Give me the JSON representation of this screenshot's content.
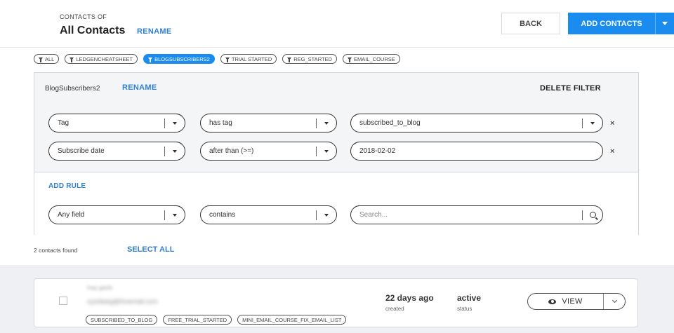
{
  "header": {
    "eyebrow": "CONTACTS OF",
    "title": "All Contacts",
    "rename": "RENAME",
    "back_label": "BACK",
    "add_label": "ADD CONTACTS"
  },
  "filter_chips": [
    {
      "label": "ALL",
      "active": false
    },
    {
      "label": "LEDGENCHEATSHEET",
      "active": false
    },
    {
      "label": "BLOGSUBSCRIBERS2",
      "active": true
    },
    {
      "label": "TRIAL STARTED",
      "active": false
    },
    {
      "label": "REG_STARTED",
      "active": false
    },
    {
      "label": "EMAIL_COURSE",
      "active": false
    }
  ],
  "filter": {
    "name": "BlogSubscribers2",
    "rename": "RENAME",
    "delete": "DELETE FILTER",
    "rules": [
      {
        "field": "Tag",
        "operator": "has tag",
        "value": "subscribed_to_blog"
      },
      {
        "field": "Subscribe date",
        "operator": "after than (>=)",
        "value": "2018-02-02"
      }
    ],
    "add_rule": "ADD RULE",
    "remove_symbol": "×"
  },
  "search": {
    "field": "Any field",
    "operator": "contains",
    "placeholder": "Search..."
  },
  "results": {
    "count_text": "2 contacts found",
    "select_all": "SELECT ALL"
  },
  "contacts": [
    {
      "name": "Ivay gavle",
      "email": "xyzidweg@ihowmail.com",
      "created_value": "22 days ago",
      "created_label": "created",
      "status_value": "active",
      "status_label": "status",
      "view_label": "VIEW",
      "tags": [
        "SUBSCRIBED_TO_BLOG",
        "FREE_TRIAL_STARTED",
        "MINI_EMAIL_COURSE_FIX_EMAIL_LIST"
      ]
    }
  ],
  "colors": {
    "accent": "#1a8cf0",
    "link": "#2f80d1",
    "panel_bg": "#f4f5f7",
    "list_bg": "#eef0f3"
  }
}
